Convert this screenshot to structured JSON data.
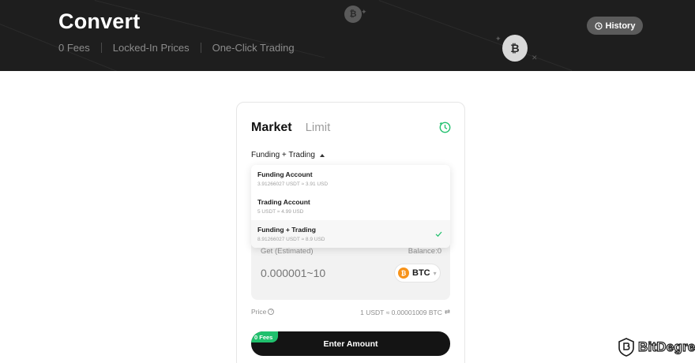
{
  "banner": {
    "title": "Convert",
    "features": [
      "0 Fees",
      "Locked-In Prices",
      "One-Click Trading"
    ],
    "history_label": "History"
  },
  "converter": {
    "tabs": [
      "Market",
      "Limit"
    ],
    "active_tab": "Market",
    "account_selector_label": "Funding + Trading",
    "get_label": "Get (Estimated)",
    "balance_label": "Balance:0",
    "amount_placeholder": "0.000001~10",
    "coin": "BTC",
    "price_label": "Price",
    "price_value": "1 USDT ≈ 0.00001009 BTC",
    "fees_badge": "0 Fees",
    "submit_label": "Enter Amount"
  },
  "dropdown": {
    "items": [
      {
        "name": "Funding Account",
        "balance": "3.91266027 USDT ≈ 3.91 USD",
        "selected": false
      },
      {
        "name": "Trading Account",
        "balance": "5 USDT ≈ 4.99 USD",
        "selected": false
      },
      {
        "name": "Funding + Trading",
        "balance": "8.91266027 USDT ≈ 8.9 USD",
        "selected": true
      }
    ]
  },
  "watermark": {
    "text": "BitDegree"
  },
  "colors": {
    "banner_bg": "#1e1e1e",
    "accent_green": "#20c06d",
    "primary_button": "#141414",
    "btc_orange": "#f7931a"
  },
  "icons": [
    "history-icon",
    "clock-icon",
    "caret-up-icon",
    "btc-icon",
    "chevron-down-icon",
    "help-icon",
    "swap-icon",
    "check-icon",
    "bitdegree-logo"
  ]
}
